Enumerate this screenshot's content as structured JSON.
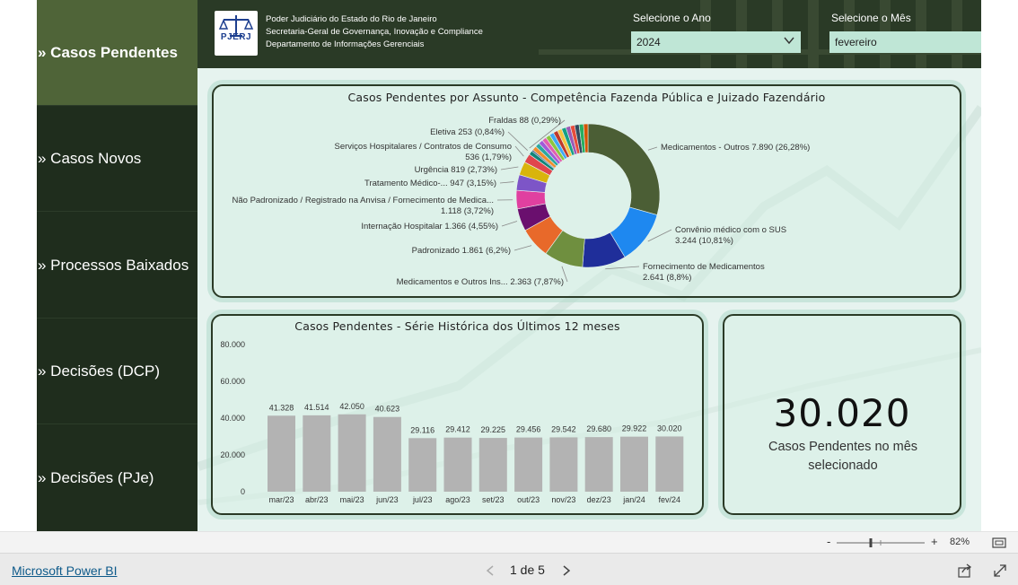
{
  "nav": {
    "items": [
      {
        "label": "» Casos Pendentes",
        "active": true
      },
      {
        "label": "» Casos Novos",
        "active": false
      },
      {
        "label": "» Processos Baixados",
        "active": false
      },
      {
        "label": "» Decisões (DCP)",
        "active": false
      },
      {
        "label": "» Decisões (PJe)",
        "active": false
      }
    ]
  },
  "header": {
    "logo_text": "PJERJ",
    "org_lines": [
      "Poder Judiciário do Estado do Rio de Janeiro",
      "Secretaria-Geral de Governança, Inovação e Compliance",
      "Departamento de Informações Gerenciais"
    ],
    "year_label": "Selecione o Ano",
    "year_value": "2024",
    "month_label": "Selecione o Mês",
    "month_value": "fevereiro"
  },
  "donut_panel": {
    "title": "Casos Pendentes por Assunto - Competência Fazenda Pública e Juizado Fazendário"
  },
  "history_panel": {
    "title": "Casos Pendentes - Série Histórica dos Últimos 12 meses"
  },
  "kpi": {
    "value": "30.020",
    "caption": "Casos Pendentes no mês selecionado"
  },
  "zoom": {
    "level": "82%",
    "minus": "-",
    "plus": "+"
  },
  "footer": {
    "brand": "Microsoft Power BI",
    "pager": "1 de 5"
  },
  "colors": {
    "sidebar": "#1f2d1d",
    "sidebar_active": "#4f6438",
    "header": "#2a3a26",
    "canvas": "#e6f3ef",
    "bar": "#b3b3b3",
    "slicer": "#bfe6d6"
  },
  "chart_data": [
    {
      "type": "pie",
      "donut": true,
      "title": "Casos Pendentes por Assunto - Competência Fazenda Pública e Juizado Fazendário",
      "labeled_slices": [
        {
          "name": "Medicamentos - Outros",
          "value": 7890,
          "value_label": "7.890 (26,28%)",
          "color": "#4b5e35"
        },
        {
          "name": "Convênio médico com o SUS",
          "value": 3244,
          "value_label": "3.244 (10,81%)",
          "color": "#1e88f0"
        },
        {
          "name": "Fornecimento de Medicamentos",
          "value": 2641,
          "value_label": "2.641 (8,8%)",
          "color": "#1f2e9a"
        },
        {
          "name": "Medicamentos e Outros Ins...",
          "value": 2363,
          "value_label": "2.363 (7,87%)",
          "color": "#6f8f3f"
        },
        {
          "name": "Padronizado",
          "value": 1861,
          "value_label": "1.861 (6,2%)",
          "color": "#e8692a"
        },
        {
          "name": "Internação Hospitalar",
          "value": 1366,
          "value_label": "1.366 (4,55%)",
          "color": "#6a0f6e"
        },
        {
          "name": "Não Padronizado / Registrado na Anvisa / Fornecimento de Medica...",
          "value": 1118,
          "value_label": "1.118 (3,72%)",
          "color": "#e040a0"
        },
        {
          "name": "Tratamento Médico-...",
          "value": 947,
          "value_label": "947 (3,15%)",
          "color": "#7d55c7"
        },
        {
          "name": "Urgência",
          "value": 819,
          "value_label": "819 (2,73%)",
          "color": "#d9b40c"
        },
        {
          "name": "Serviços Hospitalares / Contratos de Consumo",
          "value": 536,
          "value_label": "536 (1,79%)",
          "color": "#e0454d"
        },
        {
          "name": "Eletiva",
          "value": 253,
          "value_label": "253 (0,84%)",
          "color": "#10857a"
        },
        {
          "name": "Fraldas",
          "value": 88,
          "value_label": "88 (0,29%)",
          "color": "#2c3e7a"
        }
      ],
      "unlabeled_small_slices_colors": [
        "#f08e2f",
        "#2ca8a0",
        "#a259d9",
        "#e25fb0",
        "#8cc63f",
        "#3fa9f5",
        "#c0392b",
        "#f5c542",
        "#16a085",
        "#9b59b6",
        "#e74c3c",
        "#34495e",
        "#27ae60",
        "#d35400"
      ]
    },
    {
      "type": "bar",
      "title": "Casos Pendentes - Série Histórica dos Últimos 12 meses",
      "categories": [
        "mar/23",
        "abr/23",
        "mai/23",
        "jun/23",
        "jul/23",
        "ago/23",
        "set/23",
        "out/23",
        "nov/23",
        "dez/23",
        "jan/24",
        "fev/24"
      ],
      "values": [
        41328,
        41514,
        42050,
        40623,
        29116,
        29412,
        29225,
        29456,
        29542,
        29680,
        29922,
        30020
      ],
      "value_labels": [
        "41.328",
        "41.514",
        "42.050",
        "40.623",
        "29.116",
        "29.412",
        "29.225",
        "29.456",
        "29.542",
        "29.680",
        "29.922",
        "30.020"
      ],
      "ylim": [
        0,
        80000
      ],
      "yticks": [
        "80.000",
        "60.000",
        "40.000",
        "20.000",
        "0"
      ],
      "grid": false
    }
  ]
}
